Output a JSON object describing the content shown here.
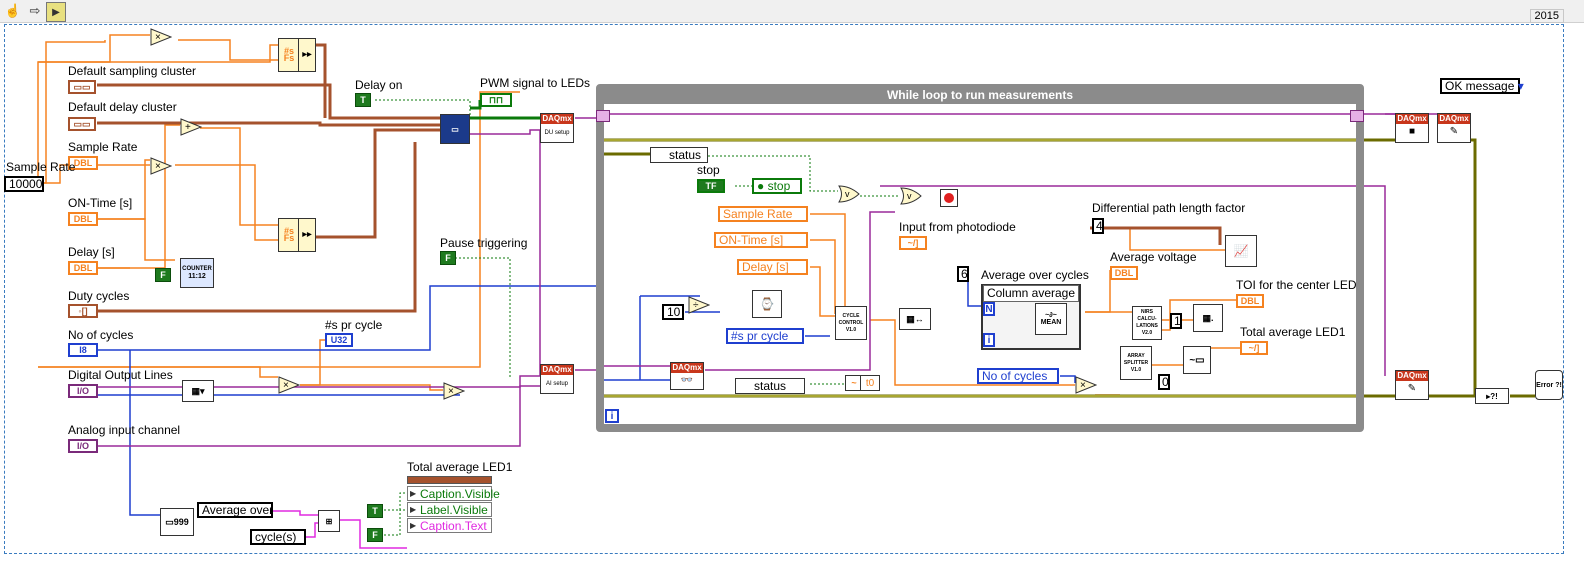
{
  "toolbar": {
    "version": "2015",
    "icons": [
      "hand-tool-icon",
      "forward-arrow-icon",
      "highlight-execution-icon"
    ]
  },
  "colors": {
    "orange": "#f58220",
    "blue": "#1f3fcf",
    "brown": "#a5522d",
    "purple": "#7a2a7a",
    "green": "#0b7a0b",
    "pink": "#e02ae0",
    "loop": "#8b8b8b"
  },
  "labels": {
    "default_sampling_cluster": "Default sampling cluster",
    "default_delay_cluster": "Default delay cluster",
    "sample_rate_label": "Sample Rate",
    "sample_rate_outer": "Sample Rate",
    "on_time": "ON-Time [s]",
    "delay": "Delay [s]",
    "duty_cycles": "Duty cycles",
    "no_of_cycles": "No of cycles",
    "digital_output_lines": "Digital Output Lines",
    "analog_input_channel": "Analog input channel",
    "delay_on": "Delay on",
    "pwm_signal": "PWM signal to LEDs",
    "pause_triggering": "Pause triggering",
    "samples_pr_cycle": "#s pr cycle",
    "total_average_led1_top": "Total average LED1",
    "stop": "stop",
    "input_from_photodiode": "Input from photodiode",
    "differential_path_length": "Differential path length factor",
    "average_over_cycles": "Average over cycles",
    "average_voltage": "Average voltage",
    "toi_center_led": "TOI for the center LED",
    "total_average_led1": "Total average LED1",
    "column_average": "Column average",
    "mean": "MEAN"
  },
  "terminals": {
    "dbl": "DBL",
    "i8": "I8",
    "u32": "U32",
    "io": "I/O",
    "tf": "TF"
  },
  "values": {
    "sample_rate": "10000",
    "constant_10": "10",
    "constant_6": "6",
    "constant_4": "4",
    "constant_1": "1",
    "constant_0": "0",
    "bool_true": "T",
    "bool_false": "F",
    "n": "N",
    "i": "i",
    "t0": "t0",
    "fs": "Fs",
    "ns": "#s"
  },
  "loop": {
    "title": "While loop to run measurements"
  },
  "local_vars": {
    "sample_rate": "Sample Rate",
    "on_time": "ON-Time [s]",
    "delay": "Delay [s]",
    "samples_pr_cycle": "#s pr cycle",
    "no_of_cycles": "No of cycles",
    "stop": "stop"
  },
  "status": {
    "first": "status",
    "second": "status"
  },
  "strings": {
    "average_over": "Average over",
    "cycles": "cycle(s)"
  },
  "property_node": {
    "title": "Total average LED1",
    "props": [
      "Caption.Visible",
      "Label.Visible",
      "Caption.Text"
    ]
  },
  "ok_message": {
    "value": "OK message"
  },
  "subvis": {
    "cycle_control": "CYCLE CONTROL V1.0",
    "nirs_calc": "NIRS CALCU-LATIONS V2.0",
    "array_splitter": "ARRAY SPLITTER V1.0",
    "counter": "COUNTER",
    "counter_time": "11:12",
    "error": "Error ?!",
    "du_setup": "DU setup",
    "ai_setup": "AI setup",
    "daqmx": "DAQmx"
  }
}
